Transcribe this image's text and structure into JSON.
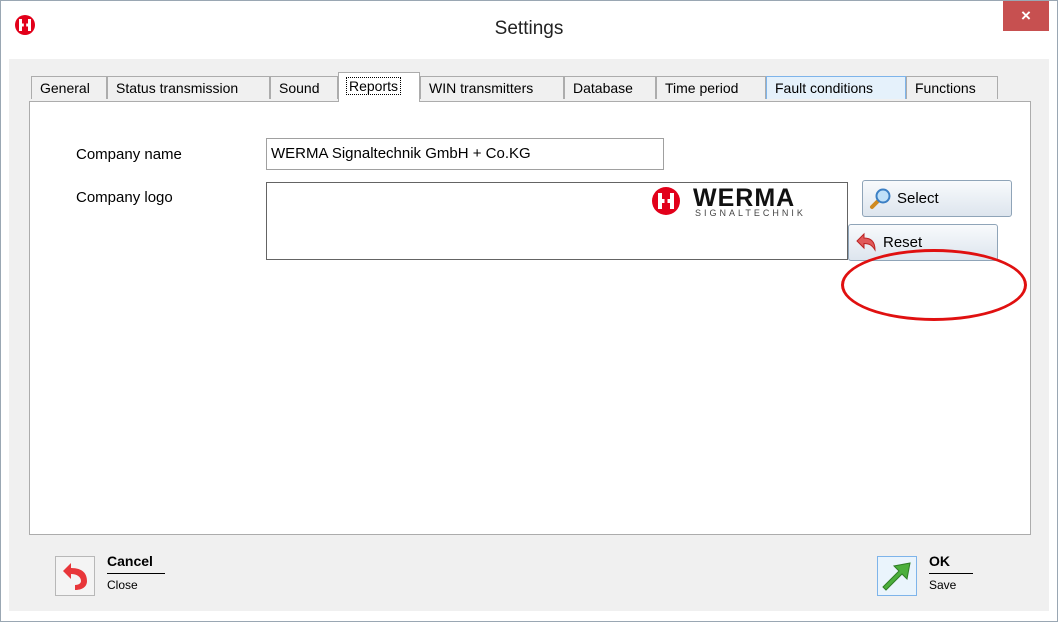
{
  "window": {
    "title": "Settings",
    "close_glyph": "×"
  },
  "tabs": [
    {
      "label": "General",
      "state": "normal"
    },
    {
      "label": "Status transmission",
      "state": "normal"
    },
    {
      "label": "Sound",
      "state": "normal"
    },
    {
      "label": "Reports",
      "state": "active"
    },
    {
      "label": "WIN transmitters",
      "state": "normal"
    },
    {
      "label": "Database",
      "state": "normal"
    },
    {
      "label": "Time period",
      "state": "normal"
    },
    {
      "label": "Fault conditions",
      "state": "highlighted"
    },
    {
      "label": "Functions",
      "state": "normal"
    }
  ],
  "reports": {
    "company_name_label": "Company name",
    "company_name_value": "WERMA Signaltechnik GmbH + Co.KG",
    "company_logo_label": "Company logo",
    "logo": {
      "name": "WERMA",
      "tagline": "SIGNALTECHNIK"
    },
    "select_label": "Select",
    "reset_label": "Reset"
  },
  "footer": {
    "cancel": {
      "title": "Cancel",
      "subtitle": "Close"
    },
    "ok": {
      "title": "OK",
      "subtitle": "Save"
    }
  },
  "icons": {
    "app_logo": "werma-logo-icon",
    "select": "magnifier-icon",
    "reset": "undo-arrow-icon",
    "cancel": "return-arrow-icon",
    "ok": "green-arrow-icon"
  },
  "colors": {
    "close_button": "#c75050",
    "highlight_ring": "#e01010",
    "werma_red": "#e2001a",
    "ok_green": "#4caf3c"
  }
}
